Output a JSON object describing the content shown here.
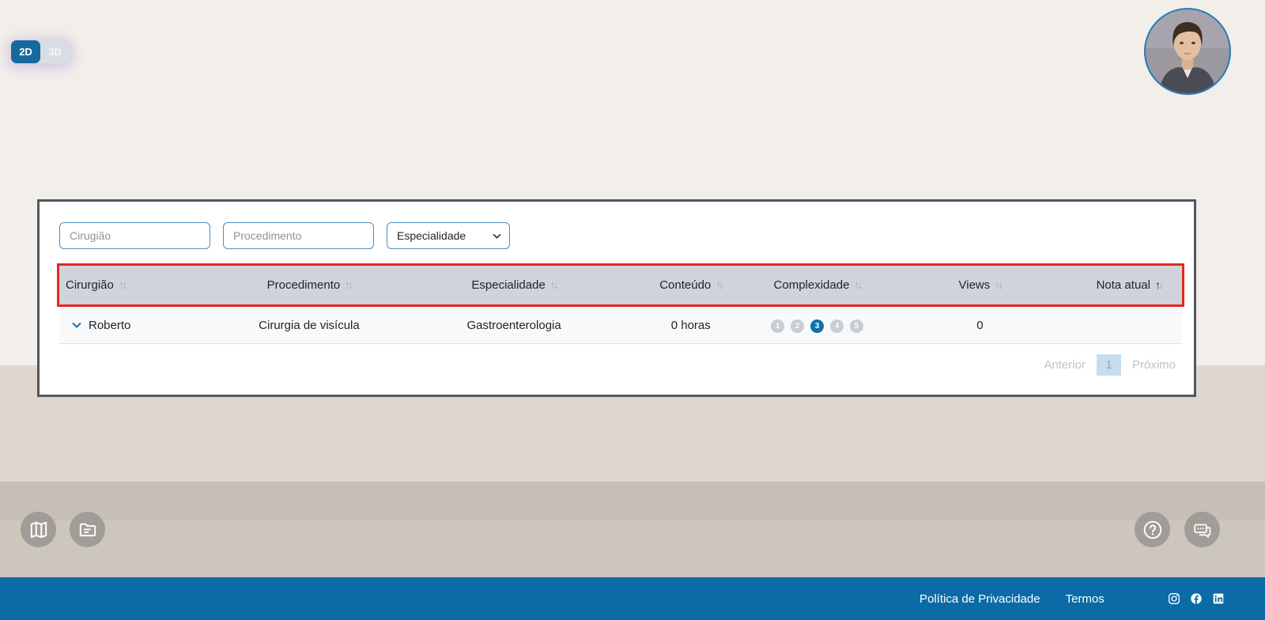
{
  "view_toggle": {
    "option_2d": "2D",
    "option_3d": "3D"
  },
  "filters": {
    "cirugiao_placeholder": "Cirugião",
    "procedimento_placeholder": "Procedimento",
    "especialidade_selected": "Especialidade"
  },
  "table": {
    "headers": [
      {
        "label": "Cirurgião",
        "sort": "none"
      },
      {
        "label": "Procedimento",
        "sort": "none"
      },
      {
        "label": "Especialidade",
        "sort": "none"
      },
      {
        "label": "Conteúdo",
        "sort": "none"
      },
      {
        "label": "Complexidade",
        "sort": "none"
      },
      {
        "label": "Views",
        "sort": "none"
      },
      {
        "label": "Nota atual",
        "sort": "asc"
      }
    ],
    "rows": [
      {
        "cirurgiao": "Roberto",
        "procedimento": "Cirurgia de visícula",
        "especialidade": "Gastroenterologia",
        "conteudo": "0 horas",
        "complexidade": {
          "levels": [
            "1",
            "2",
            "3",
            "4",
            "5"
          ],
          "active": "3"
        },
        "views": "0",
        "nota_atual": ""
      }
    ]
  },
  "pagination": {
    "previous_label": "Anterior",
    "current_page": "1",
    "next_label": "Próximo"
  },
  "footer": {
    "privacy_label": "Política de Privacidade",
    "terms_label": "Termos",
    "social_icons": [
      "instagram-icon",
      "facebook-icon",
      "linkedin-icon"
    ]
  },
  "icons": {
    "left_fabs": [
      "map-icon",
      "folder-icon"
    ],
    "right_fabs": [
      "help-icon",
      "chat-icon"
    ]
  },
  "colors": {
    "accent_blue": "#16699f",
    "footer_blue": "#0b6ba6",
    "annotation_red": "#e8261f",
    "header_bg": "#ced4da",
    "badge_active": "#0f72ad"
  }
}
